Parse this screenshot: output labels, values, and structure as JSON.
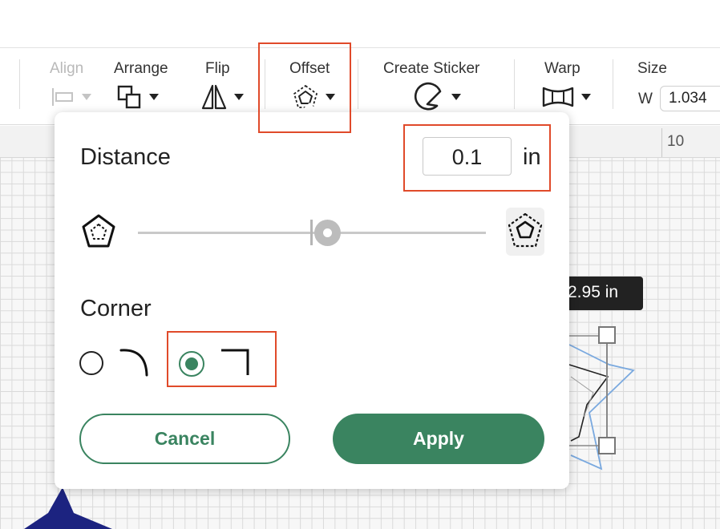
{
  "toolbar": {
    "align_label": "Align",
    "arrange_label": "Arrange",
    "flip_label": "Flip",
    "offset_label": "Offset",
    "create_sticker_label": "Create Sticker",
    "warp_label": "Warp",
    "size_label": "Size",
    "width_axis_label": "W",
    "width_value": "1.034"
  },
  "canvas": {
    "ruler_number": "10",
    "dimension_tooltip": "2.95 in"
  },
  "offset_panel": {
    "distance_label": "Distance",
    "distance_value": "0.1",
    "distance_unit": "in",
    "slider_position": 0.55,
    "corner_label": "Corner",
    "corner_options": [
      "round",
      "square"
    ],
    "corner_selected": "square",
    "cancel_label": "Cancel",
    "apply_label": "Apply"
  },
  "colors": {
    "accent_green": "#3a8460",
    "highlight_red": "#e04a2a",
    "star_navy": "#1c2380",
    "offset_outline_blue": "#7aa9df"
  },
  "icons": [
    "align-icon",
    "arrange-icon",
    "flip-icon",
    "offset-icon",
    "create-sticker-icon",
    "warp-icon",
    "offset-shrink-icon",
    "offset-grow-icon",
    "corner-round-icon",
    "corner-square-icon"
  ]
}
